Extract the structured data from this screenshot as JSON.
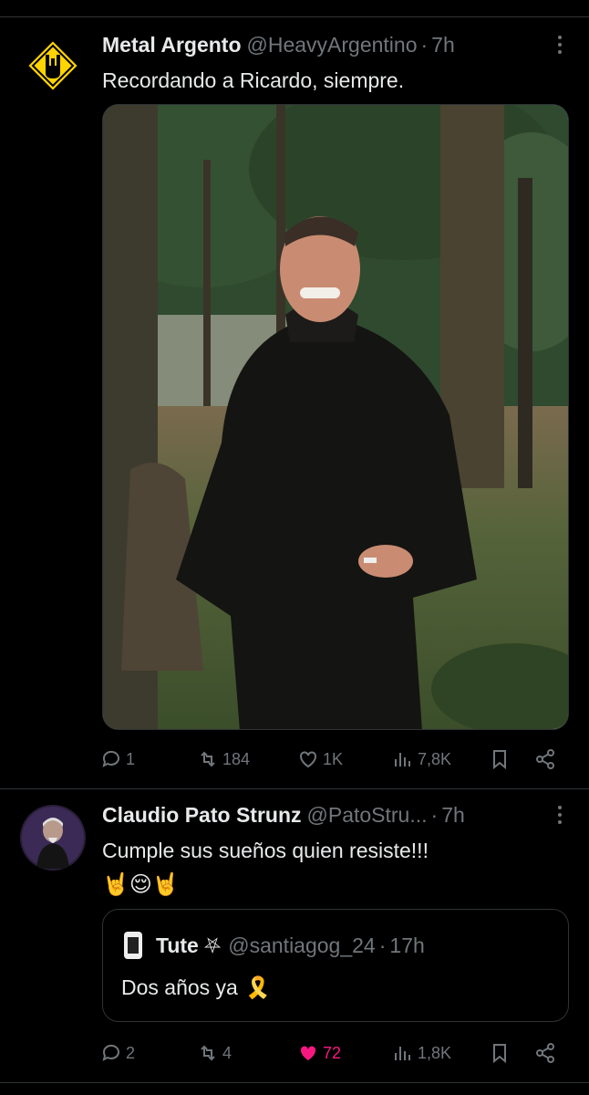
{
  "tweets": [
    {
      "name": "Metal Argento",
      "handle": "@HeavyArgentino",
      "dot": "·",
      "time": "7h",
      "text": "Recordando a Ricardo, siempre.",
      "stats": {
        "replies": "1",
        "reposts": "184",
        "likes": "1K",
        "views": "7,8K"
      },
      "avatar_icon": "rock-hand-sign-icon",
      "media": "photo-smiling-man-in-forest"
    },
    {
      "name": "Claudio Pato Strunz",
      "handle": "@PatoStru...",
      "dot": "·",
      "time": "7h",
      "text": "Cumple sus sueños quien resiste!!!",
      "emojis": "🤘😌🤘",
      "stats": {
        "replies": "2",
        "reposts": "4",
        "likes": "72",
        "views": "1,8K"
      },
      "liked": true,
      "quote": {
        "name": "Tute",
        "badge": "⛧",
        "handle": "@santiagog_24",
        "dot": "·",
        "time": "17h",
        "text": "Dos años ya",
        "ribbon": "🎗️"
      }
    }
  ],
  "colors": {
    "background": "#000000",
    "muted": "#71767b",
    "text": "#e7e9ea",
    "like": "#f91880",
    "divider": "#2f3336"
  }
}
